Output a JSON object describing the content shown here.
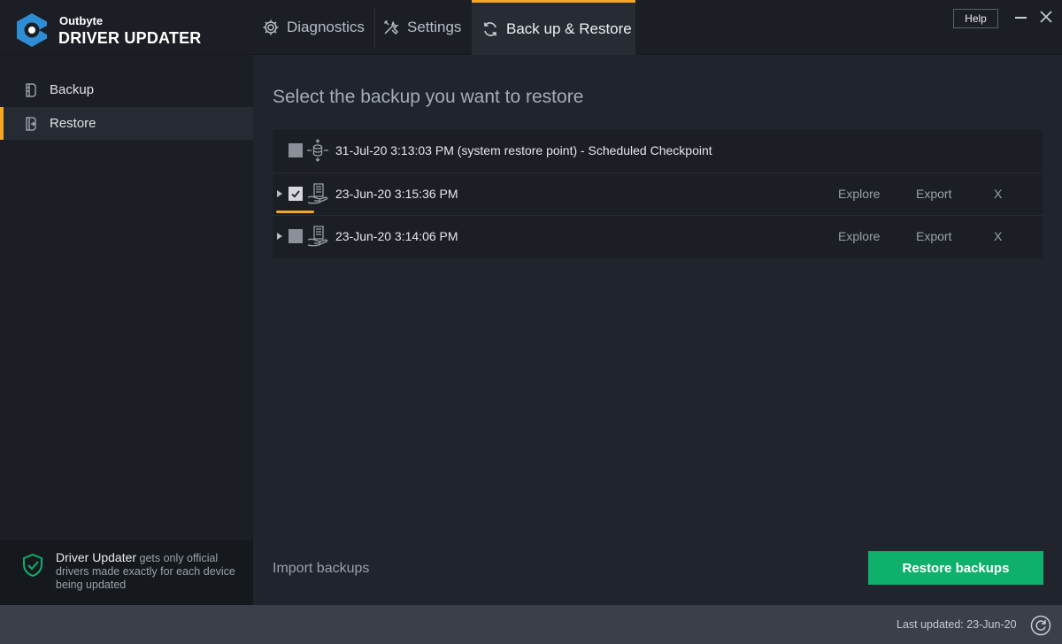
{
  "app": {
    "brand_small": "Outbyte",
    "brand_big": "DRIVER UPDATER"
  },
  "tabs": [
    {
      "label": "Diagnostics",
      "icon": "gear-icon"
    },
    {
      "label": "Settings",
      "icon": "tools-icon"
    },
    {
      "label": "Back up & Restore",
      "icon": "sync-icon",
      "active": true
    }
  ],
  "window": {
    "help_label": "Help"
  },
  "sidebar": {
    "items": [
      {
        "label": "Backup",
        "icon": "backup-icon"
      },
      {
        "label": "Restore",
        "icon": "restore-icon",
        "active": true
      }
    ],
    "promo": {
      "highlight": "Driver Updater",
      "text": " gets only official drivers made exactly for each device being updated"
    }
  },
  "main": {
    "title": "Select the backup you want to restore",
    "backups": [
      {
        "label": "31-Jul-20 3:13:03 PM (system restore point) - Scheduled Checkpoint",
        "checked": false,
        "expandable": false,
        "icon": "restore-point-icon"
      },
      {
        "label": "23-Jun-20 3:15:36 PM",
        "checked": true,
        "expandable": true,
        "icon": "driver-backup-icon",
        "explore": "Explore",
        "export": "Export",
        "delete": "X"
      },
      {
        "label": "23-Jun-20 3:14:06 PM",
        "checked": false,
        "expandable": true,
        "icon": "driver-backup-icon",
        "explore": "Explore",
        "export": "Export",
        "delete": "X"
      }
    ],
    "import_label": "Import backups",
    "restore_label": "Restore backups"
  },
  "status": {
    "last_updated": "Last updated: 23-Jun-20"
  },
  "colors": {
    "accent": "#f5a623",
    "primary_button": "#0fb06c",
    "logo": "#2d8ed6"
  }
}
